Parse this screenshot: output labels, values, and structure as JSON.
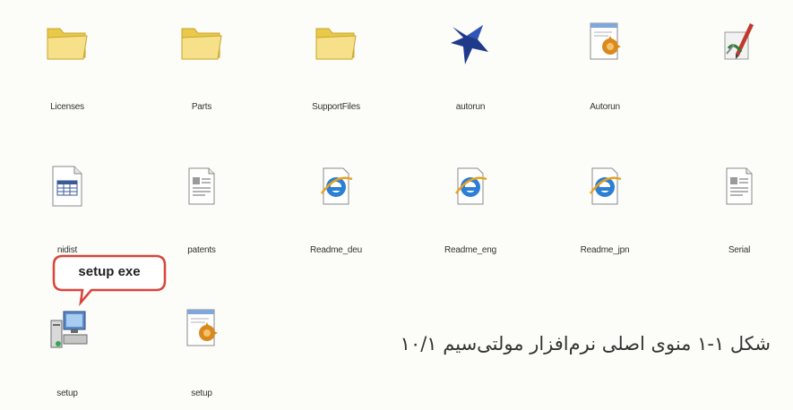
{
  "files": [
    {
      "name": "Licenses",
      "icon": "folder-icon"
    },
    {
      "name": "Parts",
      "icon": "folder-icon"
    },
    {
      "name": "SupportFiles",
      "icon": "folder-icon"
    },
    {
      "name": "autorun",
      "icon": "ni-logo-icon"
    },
    {
      "name": "Autorun",
      "icon": "setup-info-icon"
    },
    {
      "name": "",
      "icon": "pen-tool-icon"
    },
    {
      "name": "nidist",
      "icon": "spreadsheet-icon"
    },
    {
      "name": "patents",
      "icon": "text-document-icon"
    },
    {
      "name": "Readme_deu",
      "icon": "html-document-icon"
    },
    {
      "name": "Readme_eng",
      "icon": "html-document-icon"
    },
    {
      "name": "Readme_jpn",
      "icon": "html-document-icon"
    },
    {
      "name": "Serial",
      "icon": "text-document-icon"
    },
    {
      "name": "setup",
      "icon": "setup-computer-icon"
    },
    {
      "name": "setup",
      "icon": "setup-info-icon"
    }
  ],
  "callout": {
    "text": "setup exe",
    "border_color": "#d9443a"
  },
  "caption": {
    "text": "شکل ۱-۱  منوی اصلی نرم‌افزار مولتی‌سیم ۱۰/۱"
  }
}
